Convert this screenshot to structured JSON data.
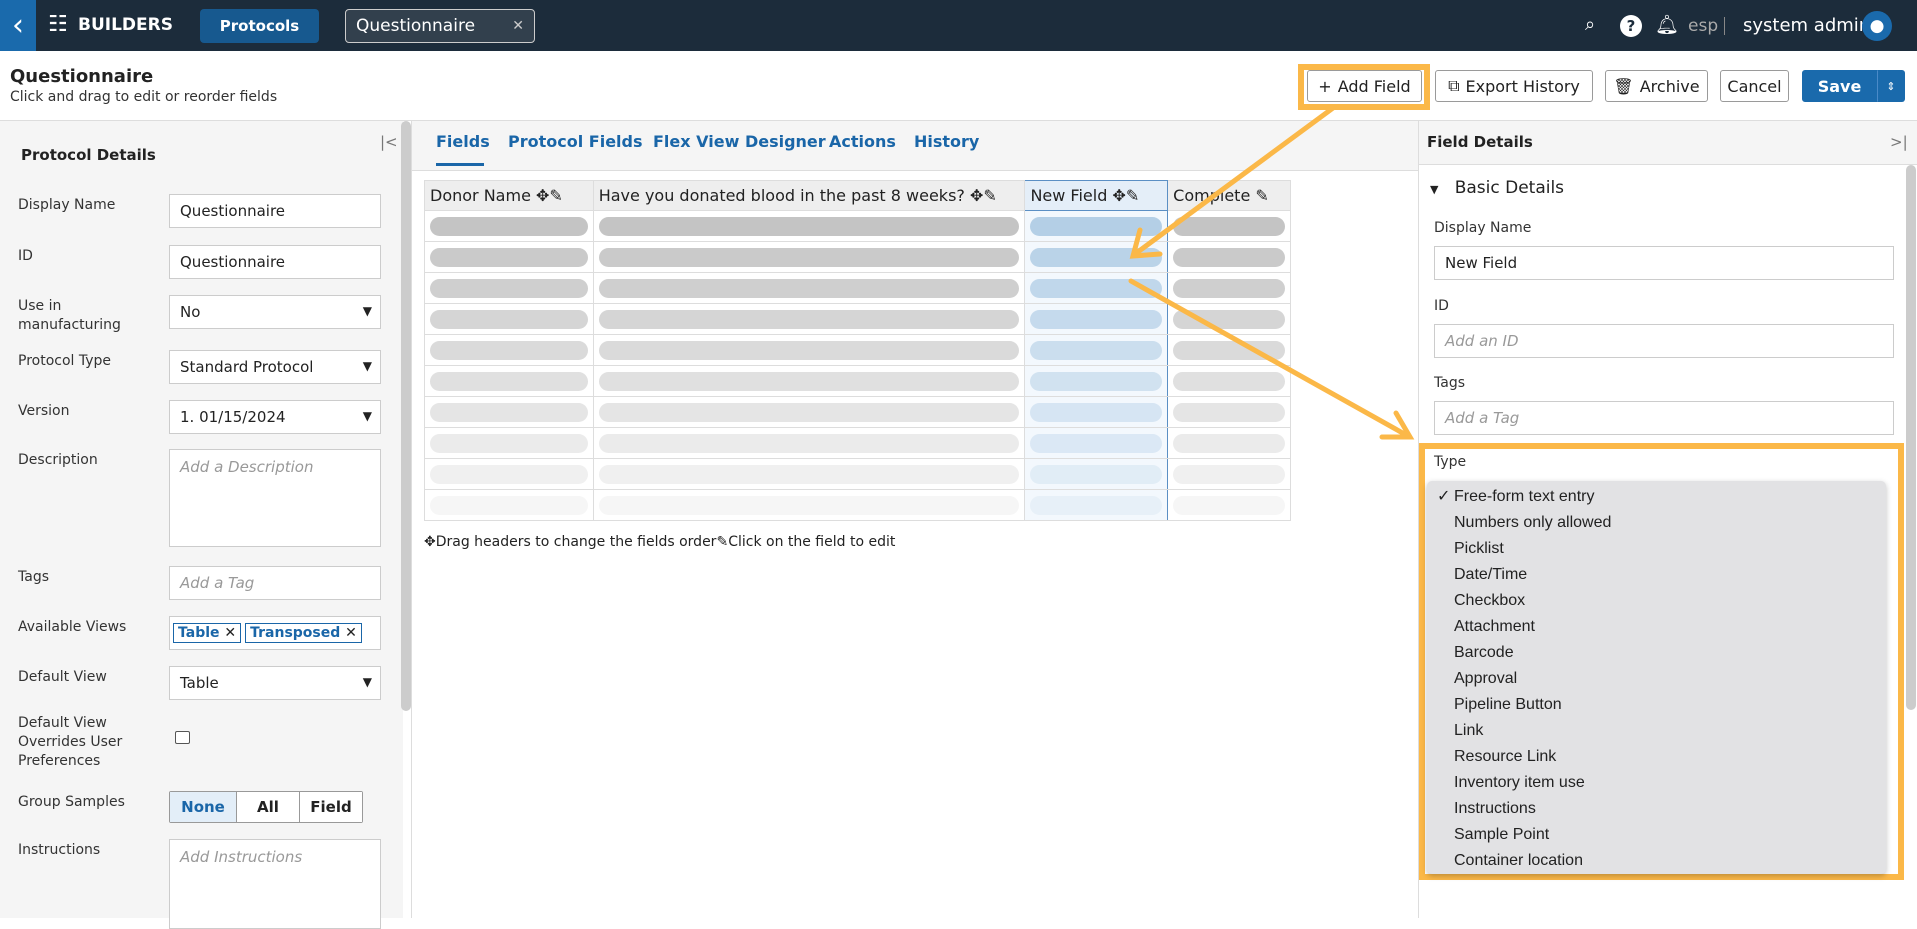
{
  "topbar": {
    "module": "BUILDERS",
    "active_nav": "Protocols",
    "open_tab": "Questionnaire",
    "language": "esp",
    "user": "system admin"
  },
  "header": {
    "title": "Questionnaire",
    "subtitle": "Click and drag to edit or reorder fields",
    "buttons": {
      "add_field": "Add Field",
      "export_history": "Export History",
      "archive": "Archive",
      "cancel": "Cancel",
      "save": "Save"
    }
  },
  "left_panel": {
    "title": "Protocol Details",
    "display_name": {
      "label": "Display Name",
      "value": "Questionnaire"
    },
    "id": {
      "label": "ID",
      "value": "Questionnaire"
    },
    "use_in_manufacturing": {
      "label": "Use in manufacturing",
      "value": "No"
    },
    "protocol_type": {
      "label": "Protocol Type",
      "value": "Standard Protocol"
    },
    "version": {
      "label": "Version",
      "value": "1. 01/15/2024"
    },
    "description": {
      "label": "Description",
      "placeholder": "Add a Description"
    },
    "tags": {
      "label": "Tags",
      "placeholder": "Add a Tag"
    },
    "available_views": {
      "label": "Available Views",
      "chips": [
        "Table",
        "Transposed"
      ]
    },
    "default_view": {
      "label": "Default View",
      "value": "Table"
    },
    "default_view_overrides": {
      "label": "Default View Overrides User Preferences",
      "checked": false
    },
    "group_samples": {
      "label": "Group Samples",
      "options": [
        "None",
        "All",
        "Field"
      ],
      "selected": "None"
    },
    "instructions": {
      "label": "Instructions",
      "placeholder": "Add Instructions"
    }
  },
  "tabs": [
    "Fields",
    "Protocol Fields",
    "Flex View Designer",
    "Actions",
    "History"
  ],
  "active_tab": "Fields",
  "table": {
    "columns": [
      "Donor Name",
      "Have you donated blood in the past 8 weeks?",
      "New Field",
      "Complete"
    ],
    "selected_column": "New Field"
  },
  "hint": {
    "drag": "Drag headers to change the fields order",
    "edit": "Click on the field to edit"
  },
  "right_panel": {
    "title": "Field Details",
    "section": "Basic Details",
    "display_name": {
      "label": "Display Name",
      "value": "New Field"
    },
    "id": {
      "label": "ID",
      "placeholder": "Add an ID"
    },
    "tags": {
      "label": "Tags",
      "placeholder": "Add a Tag"
    },
    "type": {
      "label": "Type",
      "selected": "Free-form text entry",
      "options": [
        "Free-form text entry",
        "Numbers only allowed",
        "Picklist",
        "Date/Time",
        "Checkbox",
        "Attachment",
        "Barcode",
        "Approval",
        "Pipeline Button",
        "Link",
        "Resource Link",
        "Inventory item use",
        "Instructions",
        "Sample Point",
        "Container location"
      ]
    }
  },
  "colors": {
    "topbar": "#1c2c3b",
    "accent": "#1a66a8",
    "highlight": "#fbb848"
  }
}
